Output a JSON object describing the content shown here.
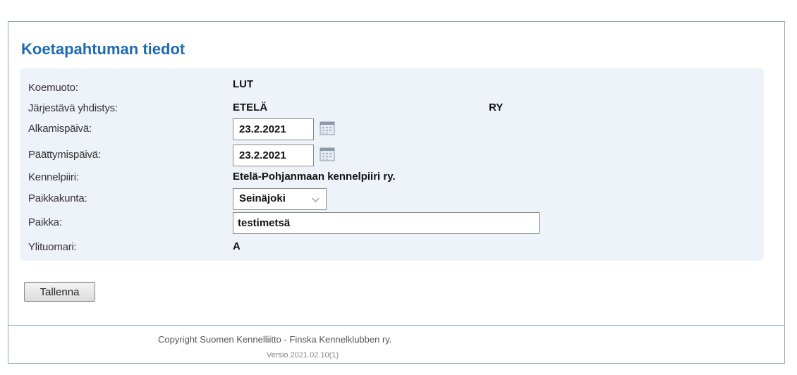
{
  "page": {
    "title": "Koetapahtuman tiedot"
  },
  "form": {
    "koemuoto": {
      "label": "Koemuoto:",
      "value": "LUT"
    },
    "jarjestava": {
      "label": "Järjestävä yhdistys:",
      "value": "ETELÄ",
      "value2": "RY"
    },
    "alkamispaiva": {
      "label": "Alkamispäivä:",
      "value": "23.2.2021"
    },
    "paattymispaiva": {
      "label": "Päättymispäivä:",
      "value": "23.2.2021"
    },
    "kennelpiiri": {
      "label": "Kennelpiiri:",
      "value": "Etelä-Pohjanmaan kennelpiiri ry."
    },
    "paikkakunta": {
      "label": "Paikkakunta:",
      "value": "Seinäjoki"
    },
    "paikka": {
      "label": "Paikka:",
      "value": "testimetsä"
    },
    "ylituomari": {
      "label": "Ylituomari:",
      "value": "A"
    }
  },
  "actions": {
    "save_label": "Tallenna"
  },
  "footer": {
    "copyright": "Copyright Suomen Kennelliitto - Finska Kennelklubben ry.",
    "version": "Versio 2021.02.10(1)"
  },
  "colors": {
    "title": "#1f6bb0",
    "panel_bg": "#eef2f9",
    "divider": "#8fb3d3"
  },
  "icons": {
    "calendar": "calendar-icon",
    "dropdown": "chevron-down-icon"
  }
}
